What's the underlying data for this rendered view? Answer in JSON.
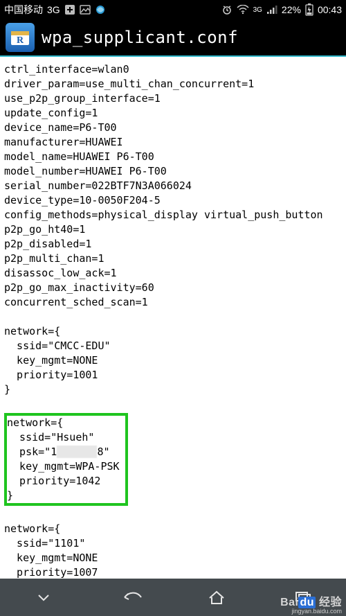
{
  "status": {
    "carrier": "中国移动",
    "network": "3G",
    "signal_extra": "3G",
    "battery_pct": "22%",
    "time": "00:43"
  },
  "app": {
    "title": "wpa_supplicant.conf"
  },
  "file": {
    "header_lines": [
      "ctrl_interface=wlan0",
      "driver_param=use_multi_chan_concurrent=1",
      "use_p2p_group_interface=1",
      "update_config=1",
      "device_name=P6-T00",
      "manufacturer=HUAWEI",
      "model_name=HUAWEI P6-T00",
      "model_number=HUAWEI P6-T00",
      "serial_number=022BTF7N3A066024",
      "device_type=10-0050F204-5",
      "config_methods=physical_display virtual_push_button",
      "p2p_go_ht40=1",
      "p2p_disabled=1",
      "p2p_multi_chan=1",
      "disassoc_low_ack=1",
      "p2p_go_max_inactivity=60",
      "concurrent_sched_scan=1"
    ],
    "networks": [
      {
        "highlighted": false,
        "lines": [
          "network={",
          "  ssid=\"CMCC-EDU\"",
          "  key_mgmt=NONE",
          "  priority=1001",
          "}"
        ]
      },
      {
        "highlighted": true,
        "lines_prefix": [
          "network={",
          "  ssid=\"Hsueh\""
        ],
        "psk_label": "  psk=\"1",
        "psk_mask": "      ",
        "psk_suffix": "8\"",
        "lines_suffix": [
          "  key_mgmt=WPA-PSK",
          "  priority=1042",
          "}"
        ]
      },
      {
        "highlighted": false,
        "lines": [
          "network={",
          "  ssid=\"1101\"",
          "  key_mgmt=NONE",
          "  priority=1007",
          "}"
        ]
      }
    ]
  },
  "watermark": {
    "brand_a": "Bai",
    "brand_b": "du",
    "brand_c": "经验",
    "url": "jingyan.baidu.com"
  },
  "icons": {
    "plus": "plus-icon",
    "picture": "picture-icon",
    "browser": "browser-icon",
    "alarm": "alarm-icon",
    "wifi": "wifi-icon",
    "signal": "signal-icon",
    "battery": "battery-icon"
  }
}
